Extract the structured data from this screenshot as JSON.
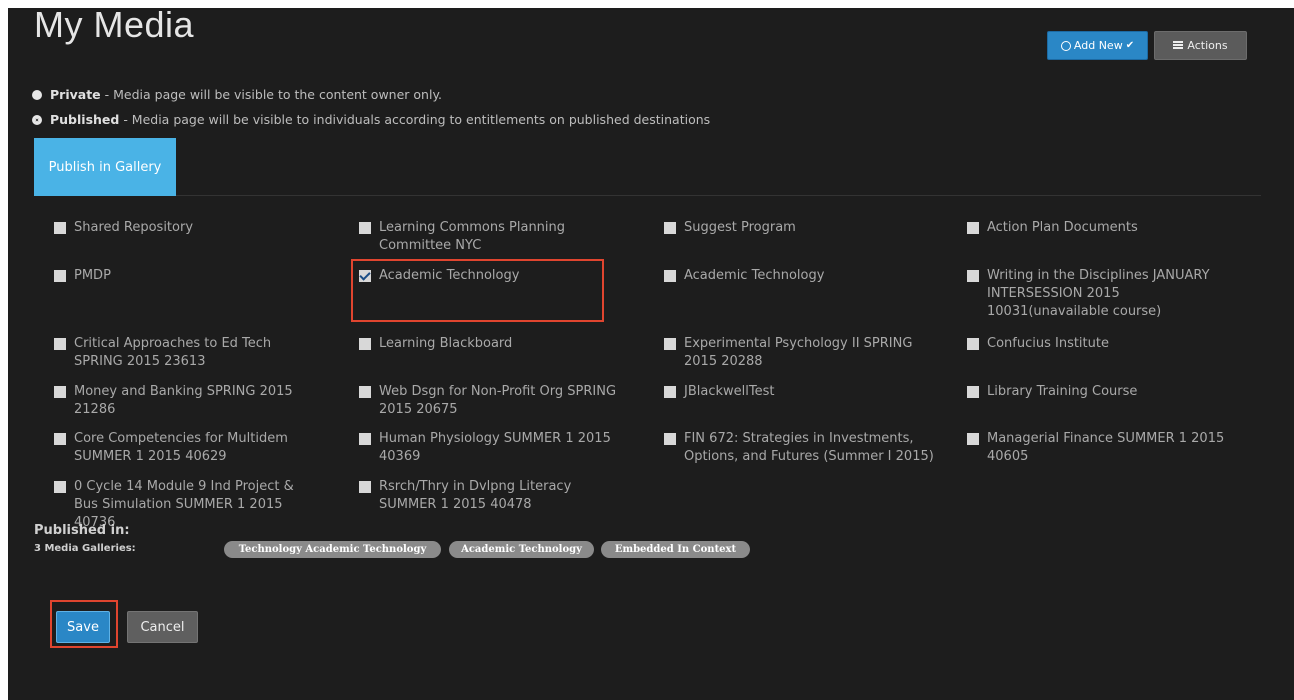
{
  "page": {
    "title": "My Media"
  },
  "toolbar": {
    "add_new_label": "Add New",
    "actions_label": "Actions"
  },
  "visibility": {
    "private": {
      "label": "Private",
      "description": " - Media page will be visible to the content owner only.",
      "selected": false
    },
    "published": {
      "label": "Published",
      "description": " - Media page will be visible to individuals according to entitlements on published destinations",
      "selected": true
    }
  },
  "tabs": {
    "publish_in_gallery": "Publish in Gallery"
  },
  "categories": [
    {
      "label": "Shared Repository",
      "checked": false
    },
    {
      "label": "Learning Commons Planning Committee NYC",
      "checked": false
    },
    {
      "label": "Suggest Program",
      "checked": false
    },
    {
      "label": "Action Plan Documents",
      "checked": false
    },
    {
      "label": "PMDP",
      "checked": false
    },
    {
      "label": "Academic Technology",
      "checked": true
    },
    {
      "label": "Academic Technology",
      "checked": false
    },
    {
      "label": "Writing in the Disciplines JANUARY INTERSESSION 2015 10031(unavailable course)",
      "checked": false
    },
    {
      "label": "Critical Approaches to Ed Tech SPRING 2015 23613",
      "checked": false
    },
    {
      "label": "Learning Blackboard",
      "checked": false
    },
    {
      "label": "Experimental Psychology II SPRING 2015 20288",
      "checked": false
    },
    {
      "label": "Confucius Institute",
      "checked": false
    },
    {
      "label": "Money and Banking SPRING 2015 21286",
      "checked": false
    },
    {
      "label": "Web Dsgn for Non-Profit Org SPRING 2015 20675",
      "checked": false
    },
    {
      "label": "JBlackwellTest",
      "checked": false
    },
    {
      "label": "Library Training Course",
      "checked": false
    },
    {
      "label": "Core Competencies for Multidem SUMMER 1 2015 40629",
      "checked": false
    },
    {
      "label": "Human Physiology SUMMER 1 2015 40369",
      "checked": false
    },
    {
      "label": "FIN 672: Strategies in Investments, Options, and Futures (Summer I 2015)",
      "checked": false
    },
    {
      "label": "Managerial Finance SUMMER 1 2015 40605",
      "checked": false
    },
    {
      "label": "0 Cycle 14 Module 9 Ind Project & Bus Simulation SUMMER 1 2015 40736",
      "checked": false
    },
    {
      "label": "Rsrch/Thry in Dvlpng Literacy SUMMER 1 2015 40478",
      "checked": false
    }
  ],
  "published_in": {
    "heading": "Published in:",
    "count_label": "3 Media Galleries:",
    "tags": [
      "Technology Academic Technology",
      "Academic Technology",
      "Embedded In Context"
    ]
  },
  "form": {
    "save_label": "Save",
    "cancel_label": "Cancel"
  }
}
